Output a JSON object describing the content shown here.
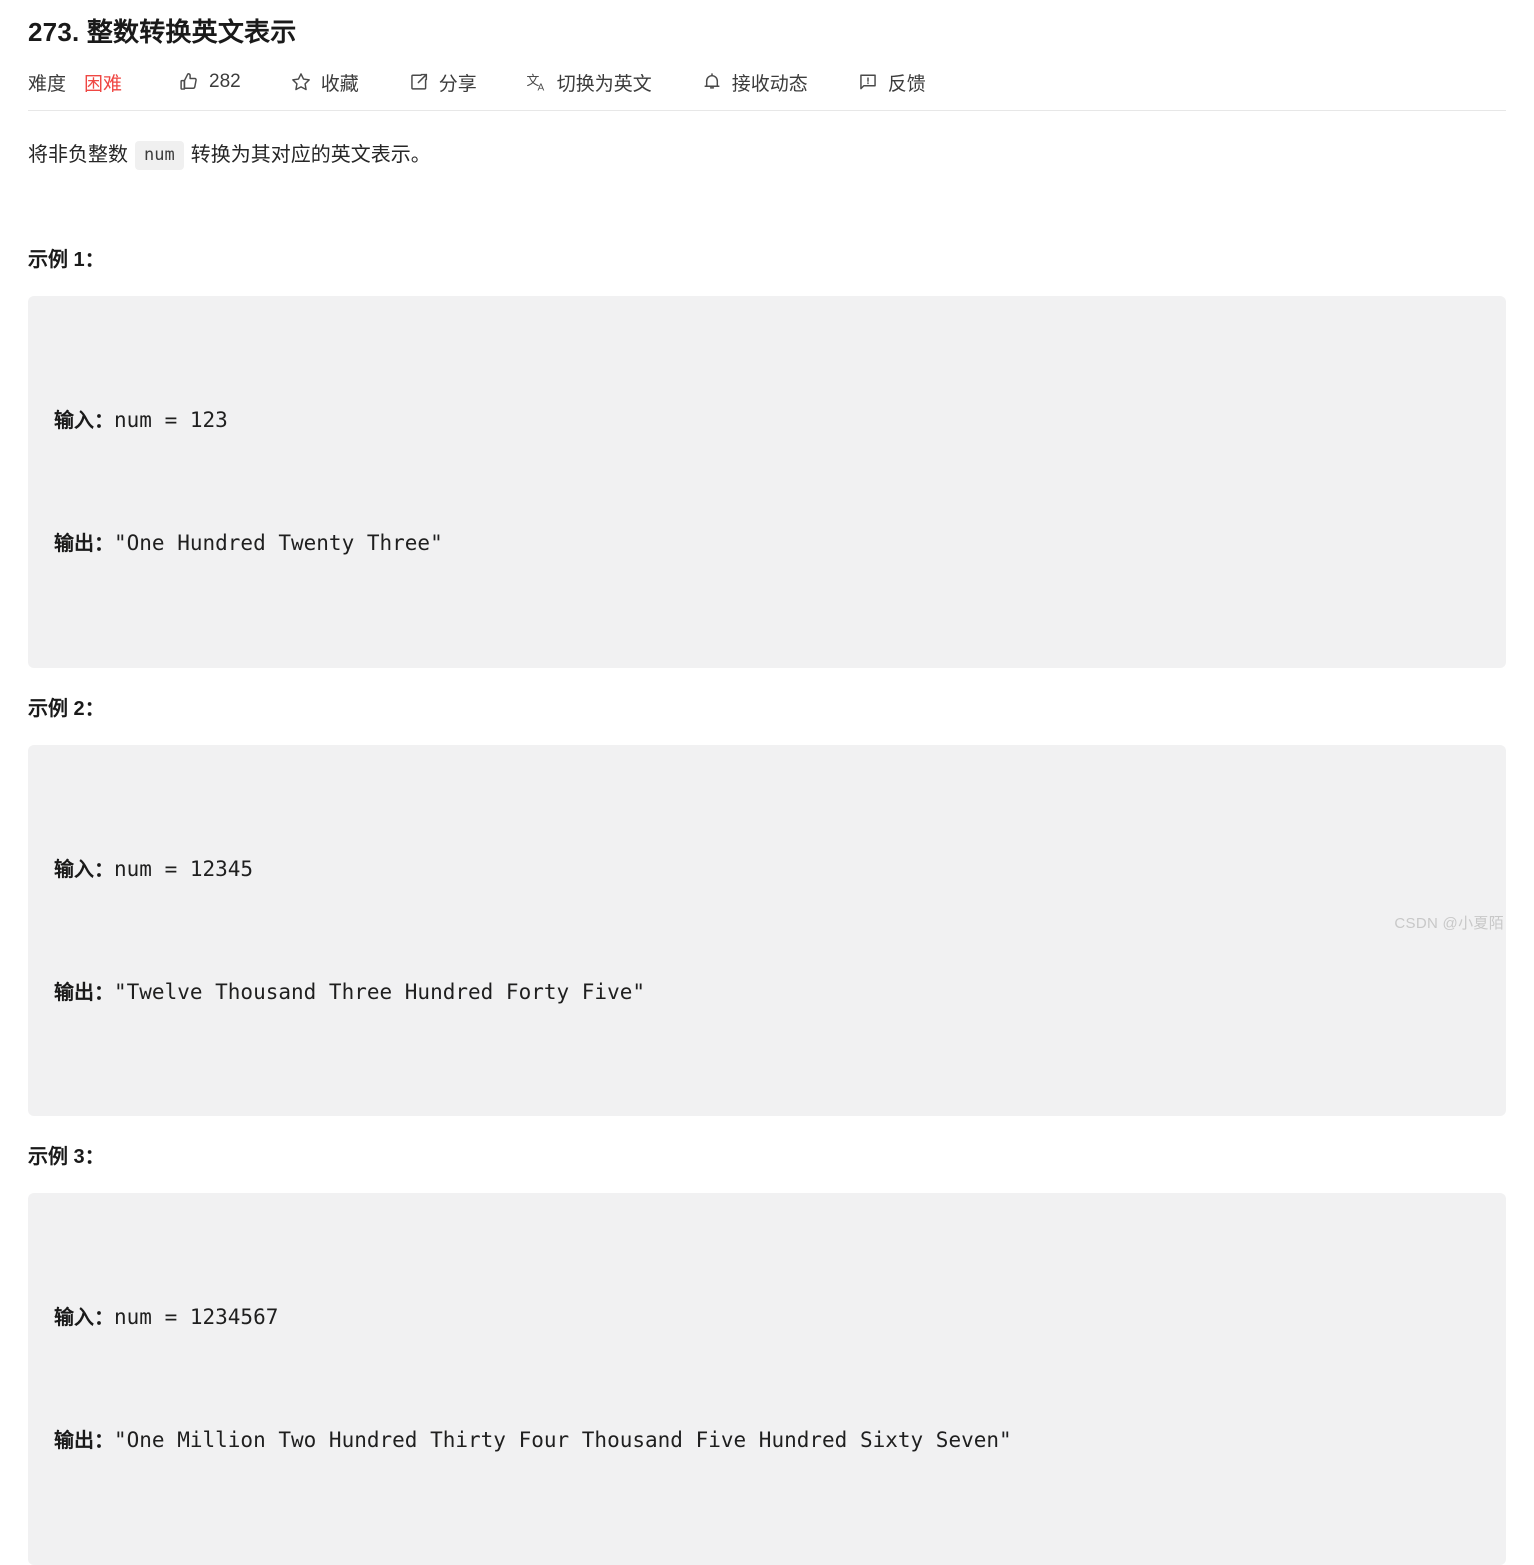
{
  "problem": {
    "title": "273. 整数转换英文表示",
    "description_prefix": "将非负整数",
    "description_code": "num",
    "description_suffix": "转换为其对应的英文表示。"
  },
  "toolbar": {
    "difficulty_label": "难度",
    "difficulty_value": "困难",
    "difficulty_color": "#ef4743",
    "like_count": "282",
    "favorite_label": "收藏",
    "share_label": "分享",
    "translate_label": "切换为英文",
    "subscribe_label": "接收动态",
    "feedback_label": "反馈",
    "icons": {
      "like": "thumbs-up-icon",
      "favorite": "star-icon",
      "share": "share-icon",
      "translate": "translate-icon",
      "subscribe": "bell-icon",
      "feedback": "feedback-icon"
    }
  },
  "examples": [
    {
      "heading": "示例 1：",
      "input_key": "输入：",
      "input_value": "num = 123",
      "output_key": "输出：",
      "output_value": "\"One Hundred Twenty Three\""
    },
    {
      "heading": "示例 2：",
      "input_key": "输入：",
      "input_value": "num = 12345",
      "output_key": "输出：",
      "output_value": "\"Twelve Thousand Three Hundred Forty Five\""
    },
    {
      "heading": "示例 3：",
      "input_key": "输入：",
      "input_value": "num = 1234567",
      "output_key": "输出：",
      "output_value": "\"One Million Two Hundred Thirty Four Thousand Five Hundred Sixty Seven\""
    }
  ],
  "watermark": "CSDN @小夏陌"
}
